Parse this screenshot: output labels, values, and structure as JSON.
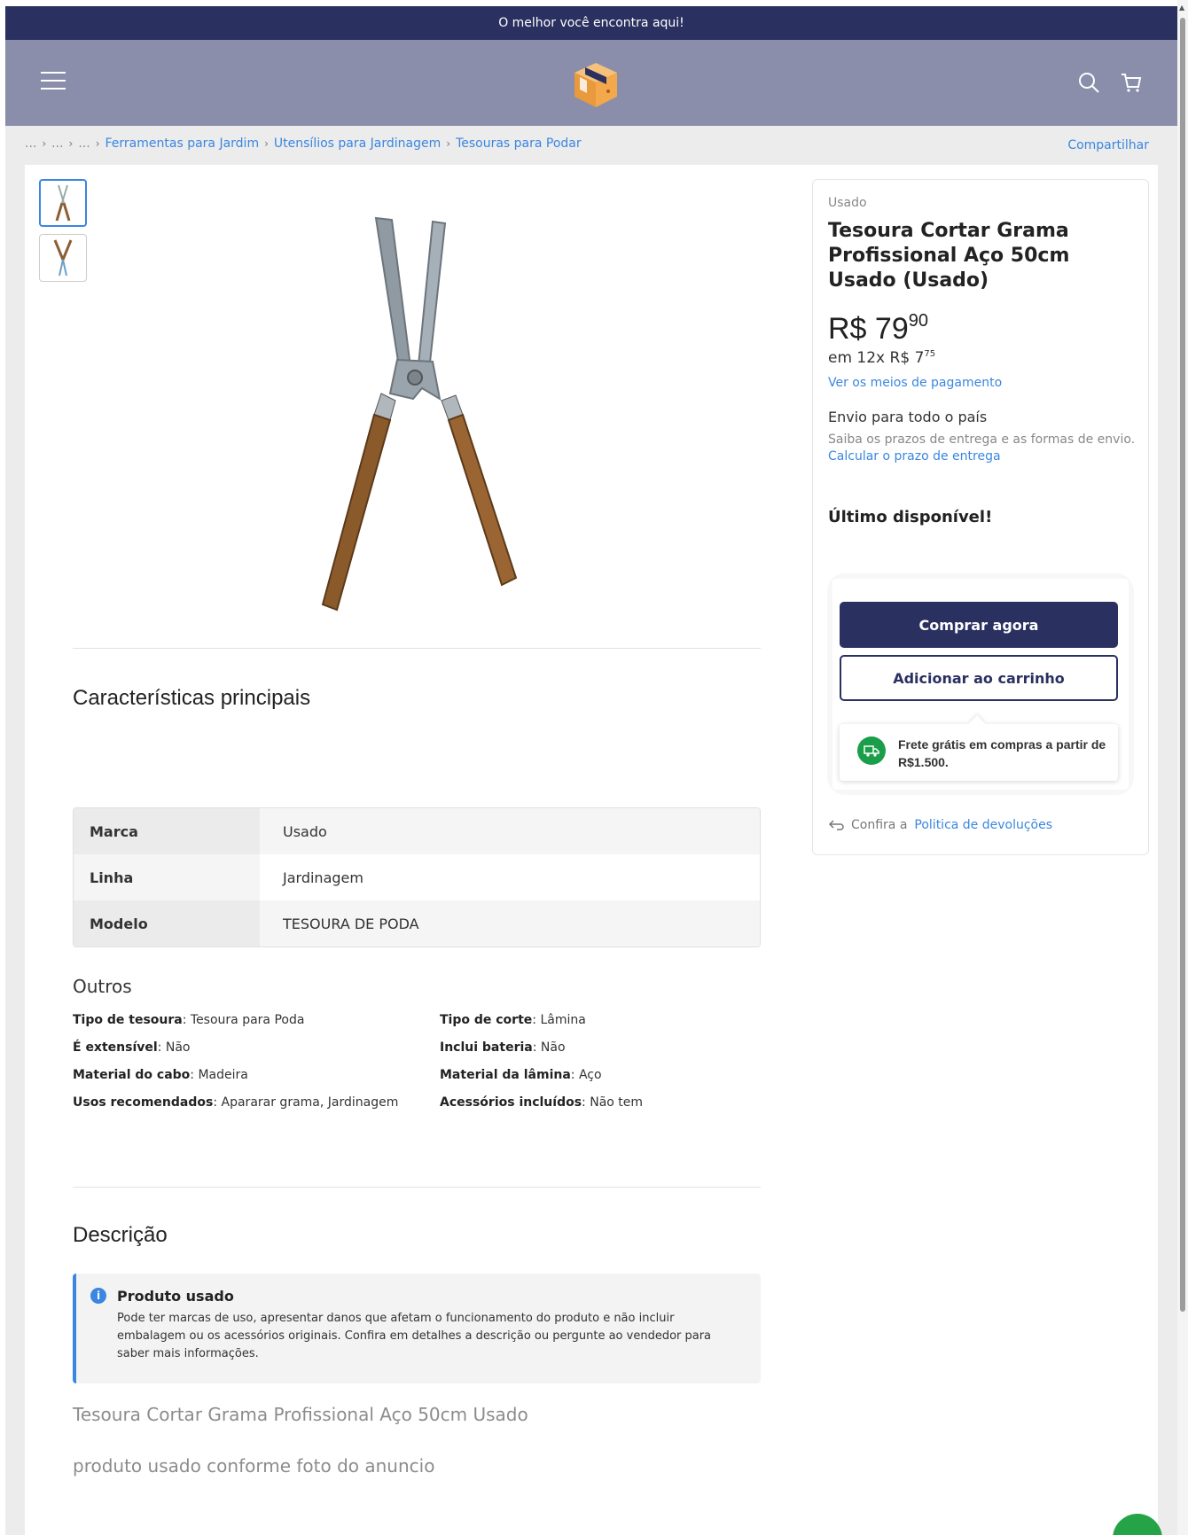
{
  "promo_bar": {
    "text": "O melhor você encontra aqui!"
  },
  "header": {
    "menu_icon": "hamburger-menu-icon",
    "logo": "package-box-logo",
    "search_icon": "search-icon",
    "cart_icon": "cart-icon"
  },
  "breadcrumb": {
    "ellipses": [
      "...",
      "...",
      "..."
    ],
    "items": [
      "Ferramentas para Jardim",
      "Utensílios para Jardinagem",
      "Tesouras para Podar"
    ],
    "share_label": "Compartilhar"
  },
  "gallery": {
    "thumbnail_count": 2,
    "selected_index": 0
  },
  "buy_box": {
    "condition": "Usado",
    "title": "Tesoura Cortar Grama Profissional Aço 50cm Usado (Usado)",
    "price_currency": "R$",
    "price_int": "79",
    "price_cents": "90",
    "installments_prefix": "em 12x R$",
    "installments_int": "7",
    "installments_cents": "75",
    "payment_link": "Ver os meios de pagamento",
    "shipping_title": "Envio para todo o país",
    "shipping_sub": "Saiba os prazos de entrega e as formas de envio.",
    "shipping_link": "Calcular o prazo de entrega",
    "stock_text": "Último disponível!",
    "buy_now_label": "Comprar agora",
    "add_to_cart_label": "Adicionar ao carrinho",
    "free_shipping_text": "Frete grátis em compras a partir de R$1.500.",
    "returns_prefix": "Confira a",
    "returns_link": "Politica de devoluções"
  },
  "characteristics": {
    "title": "Características principais",
    "rows": [
      {
        "key": "Marca",
        "value": "Usado"
      },
      {
        "key": "Linha",
        "value": "Jardinagem"
      },
      {
        "key": "Modelo",
        "value": "TESOURA DE PODA"
      }
    ],
    "others_title": "Outros",
    "others": [
      {
        "key": "Tipo de tesoura",
        "value": "Tesoura para Poda"
      },
      {
        "key": "Tipo de corte",
        "value": "Lâmina"
      },
      {
        "key": "É extensível",
        "value": "Não"
      },
      {
        "key": "Inclui bateria",
        "value": "Não"
      },
      {
        "key": "Material do cabo",
        "value": "Madeira"
      },
      {
        "key": "Material da lâmina",
        "value": "Aço"
      },
      {
        "key": "Usos recomendados",
        "value": "Apararar grama, Jardinagem"
      },
      {
        "key": "Acessórios incluídos",
        "value": "Não tem"
      }
    ]
  },
  "description": {
    "title": "Descrição",
    "notice_title": "Produto usado",
    "notice_body": "Pode ter marcas de uso, apresentar danos que afetam o funcionamento do produto e não incluir embalagem ou os acessórios originais. Confira em detalhes a descrição ou pergunte ao vendedor para saber mais informações.",
    "lines": [
      "Tesoura Cortar Grama Profissional Aço 50cm Usado",
      "produto usado conforme foto do anuncio"
    ]
  },
  "colors": {
    "primary": "#2a3160",
    "header_bg": "#8a8eab",
    "link": "#3a86e0",
    "free_shipping_green": "#1a9e4a",
    "whatsapp_green": "#25a347"
  },
  "floating": {
    "whatsapp_icon": "whatsapp-icon"
  }
}
